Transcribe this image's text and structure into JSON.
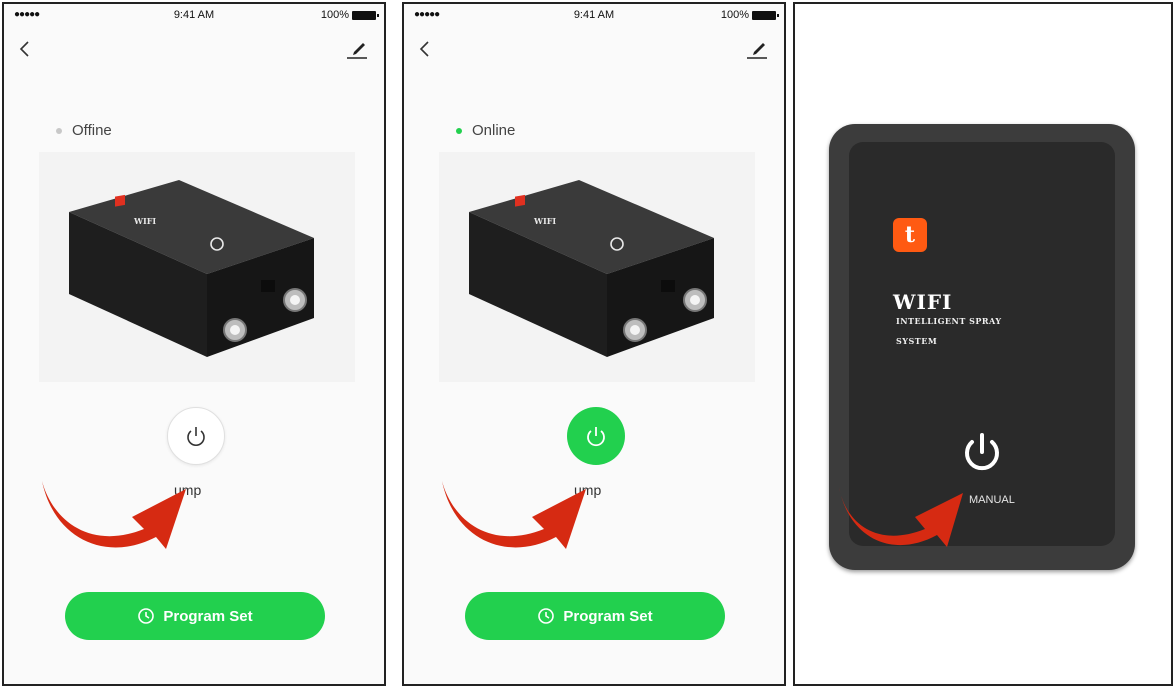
{
  "status_bar": {
    "signal": "●●●●● ",
    "time": "9:41 AM",
    "battery": "100%"
  },
  "screens": [
    {
      "status_label": "Offine",
      "status_color": "#c8c8c8",
      "power_state": "off",
      "pump_label": "ump",
      "program_label": "Program Set"
    },
    {
      "status_label": "Online",
      "status_color": "#22d04e",
      "power_state": "on",
      "pump_label": "ump",
      "program_label": "Program Set"
    }
  ],
  "device_photo": {
    "brand": "WIFI"
  },
  "hardware": {
    "logo_letter": "t",
    "title": "WIFI",
    "subtitle_line1": "INTELLIGENT SPRAY",
    "subtitle_line2": "SYSTEM",
    "manual_label": "MANUAL"
  },
  "colors": {
    "accent": "#22d04e",
    "arrow": "#d62a12",
    "logo": "#ff5a12"
  },
  "icons": [
    "back-chevron-icon",
    "edit-pencil-icon",
    "power-icon",
    "clock-icon",
    "curved-arrow-icon",
    "tuya-logo-icon"
  ]
}
